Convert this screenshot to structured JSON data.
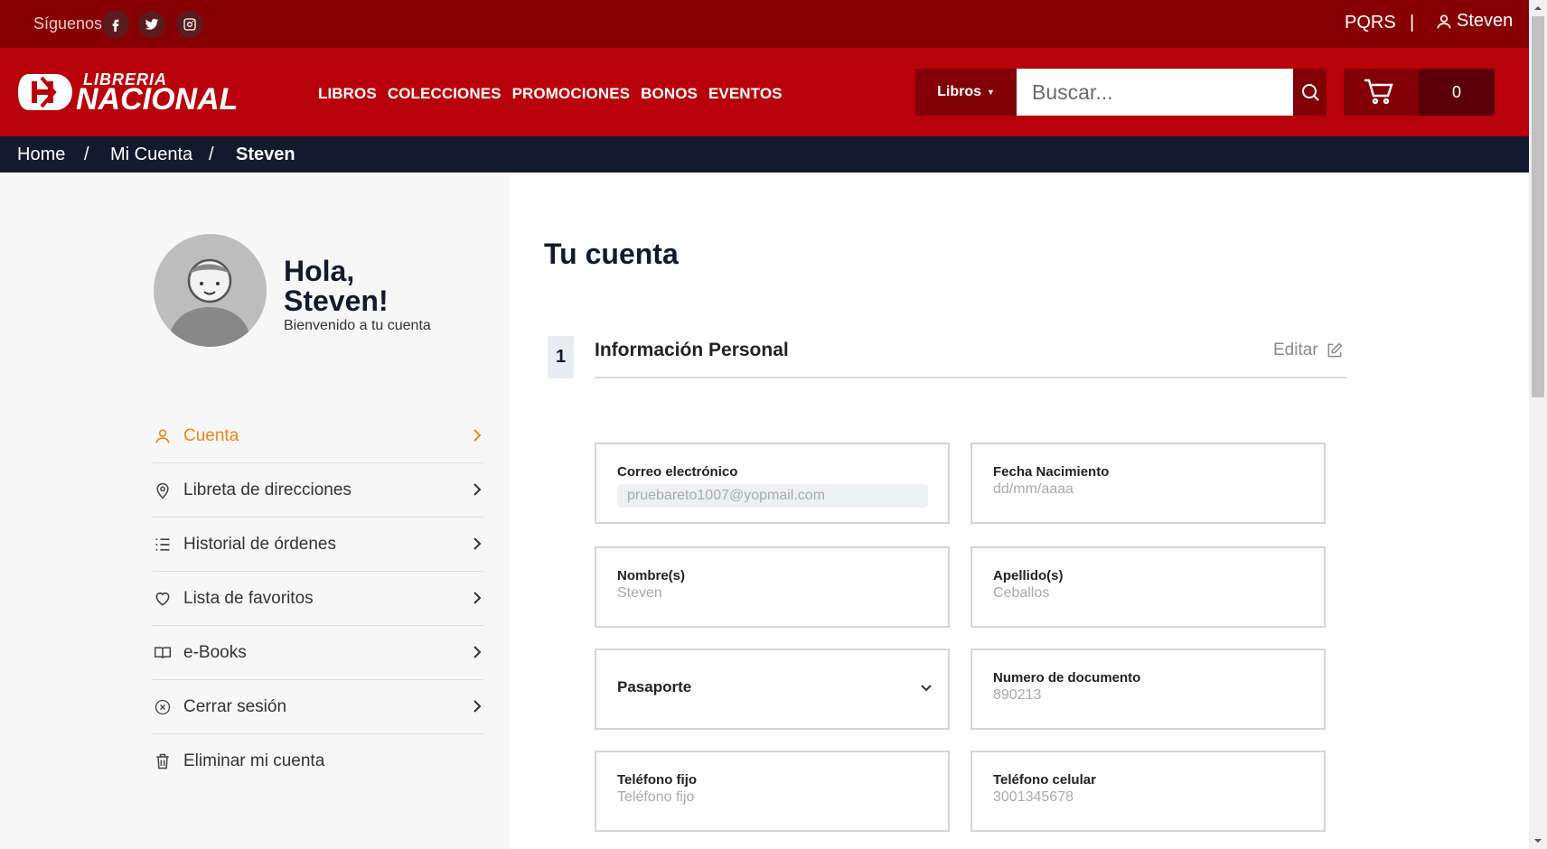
{
  "topbar": {
    "follow_label": "Síguenos",
    "pqrs": "PQRS",
    "separator": "|",
    "user": "Steven",
    "socials": [
      "facebook-icon",
      "twitter-icon",
      "instagram-icon"
    ]
  },
  "brand": {
    "top": "LIBRERIA",
    "bottom": "NACIONAL"
  },
  "nav": {
    "items": [
      "LIBROS",
      "COLECCIONES",
      "PROMOCIONES",
      "BONOS",
      "EVENTOS"
    ]
  },
  "search": {
    "category": "Libros",
    "placeholder": "Buscar..."
  },
  "cart": {
    "count": "0"
  },
  "breadcrumb": {
    "items": [
      "Home",
      "/",
      "Mi Cuenta",
      "/",
      "Steven"
    ]
  },
  "sidebar": {
    "greeting_line1": "Hola,",
    "greeting_line2": "Steven!",
    "welcome": "Bienvenido a tu cuenta",
    "items": [
      {
        "label": "Cuenta",
        "icon": "user-icon"
      },
      {
        "label": "Libreta de direcciones",
        "icon": "location-pin-icon"
      },
      {
        "label": "Historial de órdenes",
        "icon": "list-icon"
      },
      {
        "label": "Lista de favoritos",
        "icon": "heart-icon"
      },
      {
        "label": "e-Books",
        "icon": "book-icon"
      },
      {
        "label": "Cerrar sesión",
        "icon": "close-circle-icon"
      },
      {
        "label": "Eliminar mi cuenta",
        "icon": "trash-icon"
      }
    ]
  },
  "main": {
    "title": "Tu cuenta",
    "step": "1",
    "section_title": "Información Personal",
    "edit_label": "Editar",
    "fields": {
      "email": {
        "label": "Correo electrónico",
        "value": "pruebareto1007@yopmail.com"
      },
      "birth": {
        "label": "Fecha Nacimiento",
        "placeholder": "dd/mm/aaaa"
      },
      "first_name": {
        "label": "Nombre(s)",
        "value": "Steven"
      },
      "last_name": {
        "label": "Apellido(s)",
        "value": "Ceballos"
      },
      "doc_type": {
        "value": "Pasaporte"
      },
      "doc_number": {
        "label": "Numero de documento",
        "value": "890213"
      },
      "phone": {
        "label": "Teléfono fijo",
        "placeholder": "Teléfono fijo"
      },
      "mobile": {
        "label": "Teléfono celular",
        "value": "3001345678"
      }
    }
  },
  "colors": {
    "topbar": "#860003",
    "navbar": "#b8000a",
    "dark_button": "#800006",
    "breadcrumb_bg": "#121b2d",
    "active": "#e8891e"
  }
}
